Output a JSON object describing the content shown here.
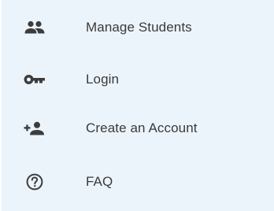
{
  "menu": {
    "items": [
      {
        "label": "Manage Students",
        "icon": "people-icon"
      },
      {
        "label": "Login",
        "icon": "key-icon"
      },
      {
        "label": "Create an Account",
        "icon": "person-add-icon"
      },
      {
        "label": "FAQ",
        "icon": "help-icon"
      }
    ]
  },
  "colors": {
    "menu_background": "#ecf4fb",
    "icon": "#3c3c3c",
    "text": "#3a3a3a"
  }
}
